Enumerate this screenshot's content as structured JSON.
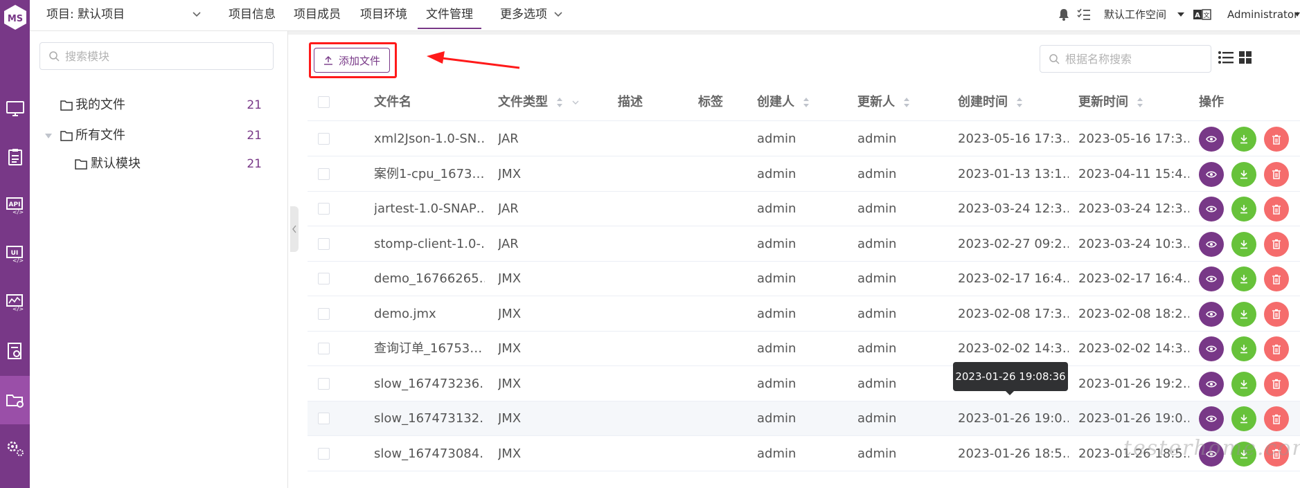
{
  "colors": {
    "brand": "#783887",
    "download": "#67c23a",
    "delete": "#f56c6c",
    "annotation": "#ff1a1a"
  },
  "header": {
    "project_selector": "项目: 默认项目",
    "nav": [
      "项目信息",
      "项目成员",
      "项目环境",
      "文件管理",
      "更多选项"
    ],
    "active_nav": "文件管理",
    "workspace": "默认工作空间",
    "user": "Administrator"
  },
  "sidebar": {
    "search_placeholder": "搜索模块",
    "tree": [
      {
        "label": "我的文件",
        "count": "21"
      },
      {
        "label": "所有文件",
        "count": "21"
      },
      {
        "label": "默认模块",
        "count": "21"
      }
    ]
  },
  "toolbar": {
    "add_file": "添加文件",
    "search_placeholder": "根据名称搜索"
  },
  "table": {
    "columns": [
      "文件名",
      "文件类型",
      "描述",
      "标签",
      "创建人",
      "更新人",
      "创建时间",
      "更新时间",
      "操作"
    ],
    "rows": [
      {
        "name": "xml2Json-1.0-SN…",
        "type": "JAR",
        "creator": "admin",
        "updater": "admin",
        "created": "2023-05-16 17:3…",
        "updated": "2023-05-16 17:3…"
      },
      {
        "name": "案例1-cpu_1673…",
        "type": "JMX",
        "creator": "admin",
        "updater": "admin",
        "created": "2023-01-13 13:1…",
        "updated": "2023-04-11 15:4…"
      },
      {
        "name": "jartest-1.0-SNAP…",
        "type": "JAR",
        "creator": "admin",
        "updater": "admin",
        "created": "2023-03-24 12:3…",
        "updated": "2023-03-24 12:3…"
      },
      {
        "name": "stomp-client-1.0-…",
        "type": "JAR",
        "creator": "admin",
        "updater": "admin",
        "created": "2023-02-27 09:2…",
        "updated": "2023-03-24 10:3…"
      },
      {
        "name": "demo_16766265…",
        "type": "JMX",
        "creator": "admin",
        "updater": "admin",
        "created": "2023-02-17 16:4…",
        "updated": "2023-02-17 16:4…"
      },
      {
        "name": "demo.jmx",
        "type": "JMX",
        "creator": "admin",
        "updater": "admin",
        "created": "2023-02-08 17:3…",
        "updated": "2023-02-08 18:2…"
      },
      {
        "name": "查询订单_16753…",
        "type": "JMX",
        "creator": "admin",
        "updater": "admin",
        "created": "2023-02-02 14:3…",
        "updated": "2023-02-02 14:3…"
      },
      {
        "name": "slow_167473236…",
        "type": "JMX",
        "creator": "admin",
        "updater": "admin",
        "created": "",
        "updated": "2023-01-26 19:2…"
      },
      {
        "name": "slow_167473132…",
        "type": "JMX",
        "creator": "admin",
        "updater": "admin",
        "created": "2023-01-26 19:0…",
        "updated": "2023-01-26 19:0…"
      },
      {
        "name": "slow_167473084…",
        "type": "JMX",
        "creator": "admin",
        "updater": "admin",
        "created": "2023-01-26 18:5…",
        "updated": "2023-01-26 18:5…"
      }
    ]
  },
  "tooltip": "2023-01-26 19:08:36",
  "watermark": "testerhome.com"
}
